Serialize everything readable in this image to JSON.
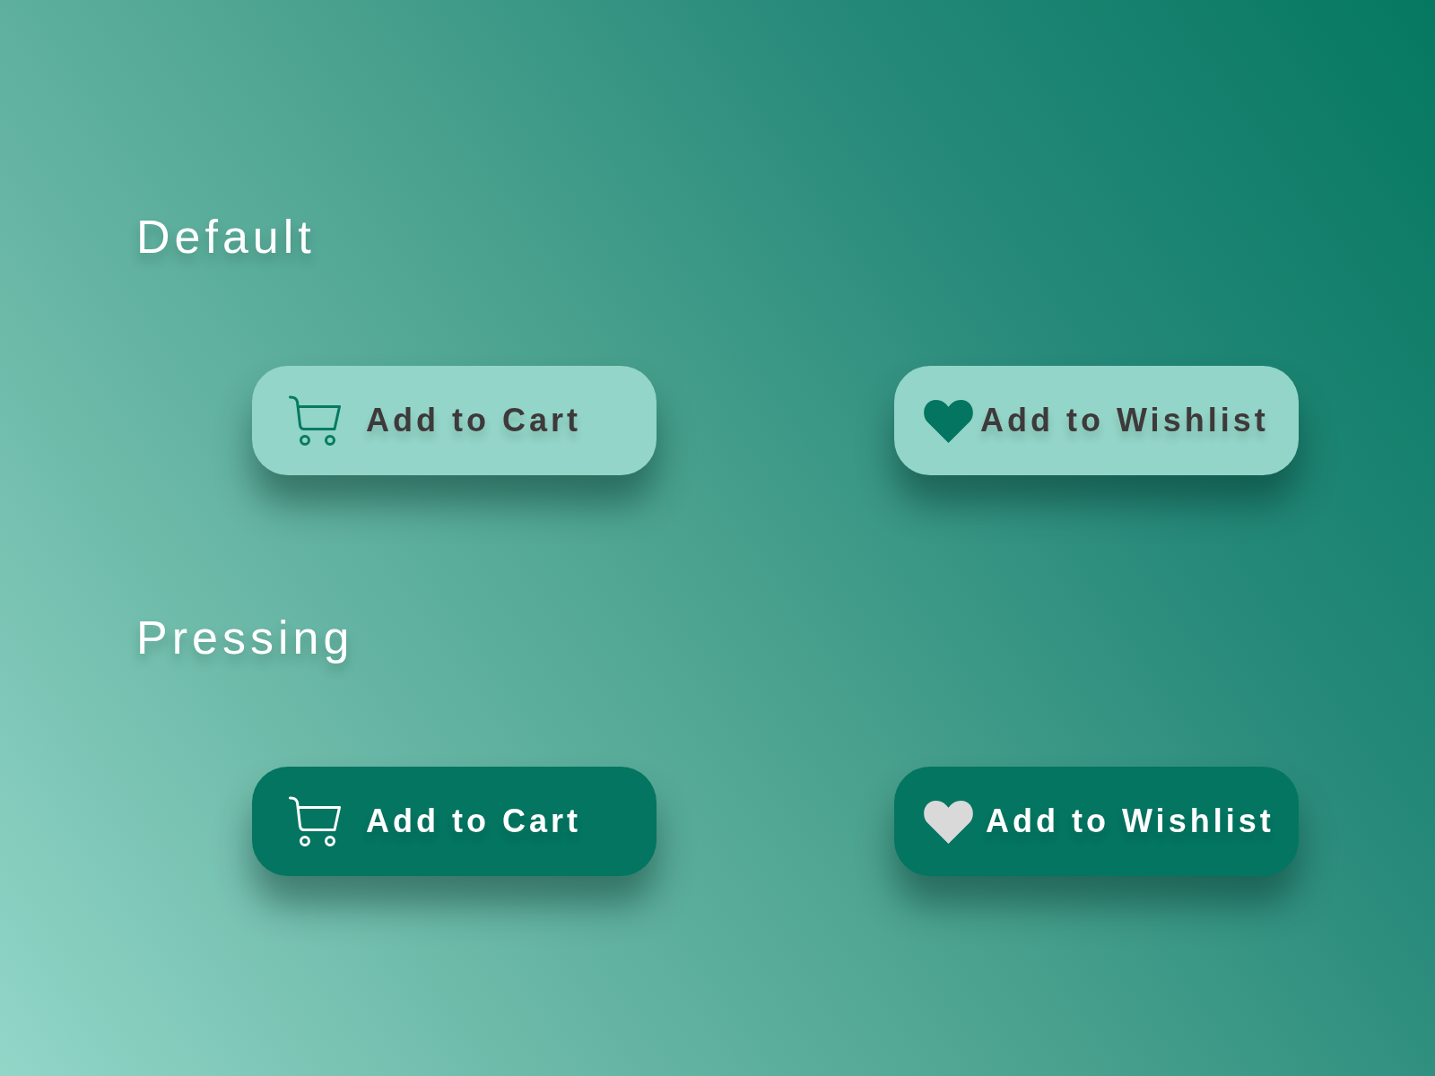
{
  "sections": [
    {
      "title": "Default",
      "buttons": [
        {
          "kind": "cart",
          "label": "Add to Cart",
          "pressed": false
        },
        {
          "kind": "wishlist",
          "label": "Add to Wishlist",
          "pressed": false
        }
      ]
    },
    {
      "title": "Pressing",
      "buttons": [
        {
          "kind": "cart",
          "label": "Add to Cart",
          "pressed": true
        },
        {
          "kind": "wishlist",
          "label": "Add to Wishlist",
          "pressed": true
        }
      ]
    }
  ]
}
